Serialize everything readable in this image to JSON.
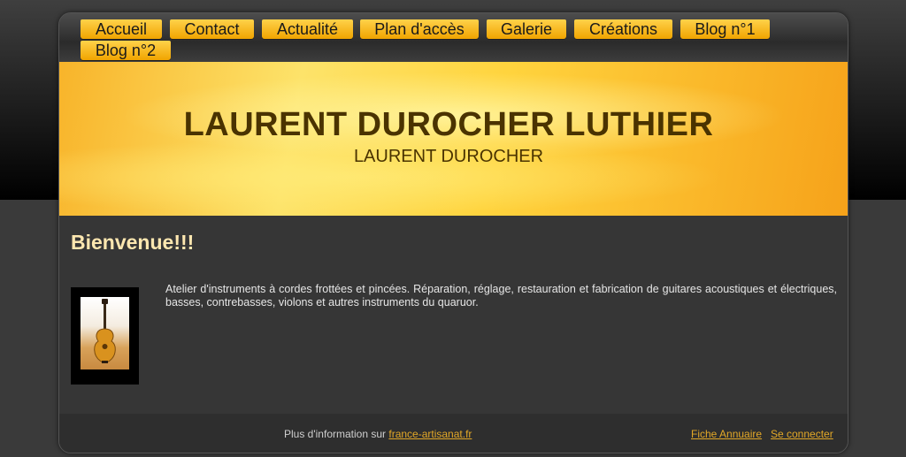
{
  "nav": {
    "items": [
      {
        "label": "Accueil"
      },
      {
        "label": "Contact"
      },
      {
        "label": "Actualité"
      },
      {
        "label": "Plan d'accès"
      },
      {
        "label": "Galerie"
      },
      {
        "label": "Créations"
      },
      {
        "label": "Blog n°1"
      },
      {
        "label": "Blog n°2"
      }
    ],
    "accent": "#f5b41c"
  },
  "header": {
    "title": "LAURENT DUROCHER LUTHIER",
    "subtitle": "LAURENT DUROCHER"
  },
  "content": {
    "title": "Bienvenue!!!",
    "intro": "Atelier d'instruments à cordes frottées et pincées. Réparation, réglage, restauration et fabrication de guitares acoustiques et électriques, basses, contrebasses, violons et autres instruments du quaruor."
  },
  "footer": {
    "info_prefix": "Plus d'information sur",
    "info_link": "france-artisanat.fr",
    "annuaire": "Fiche Annuaire",
    "connect": "Se connecter"
  }
}
